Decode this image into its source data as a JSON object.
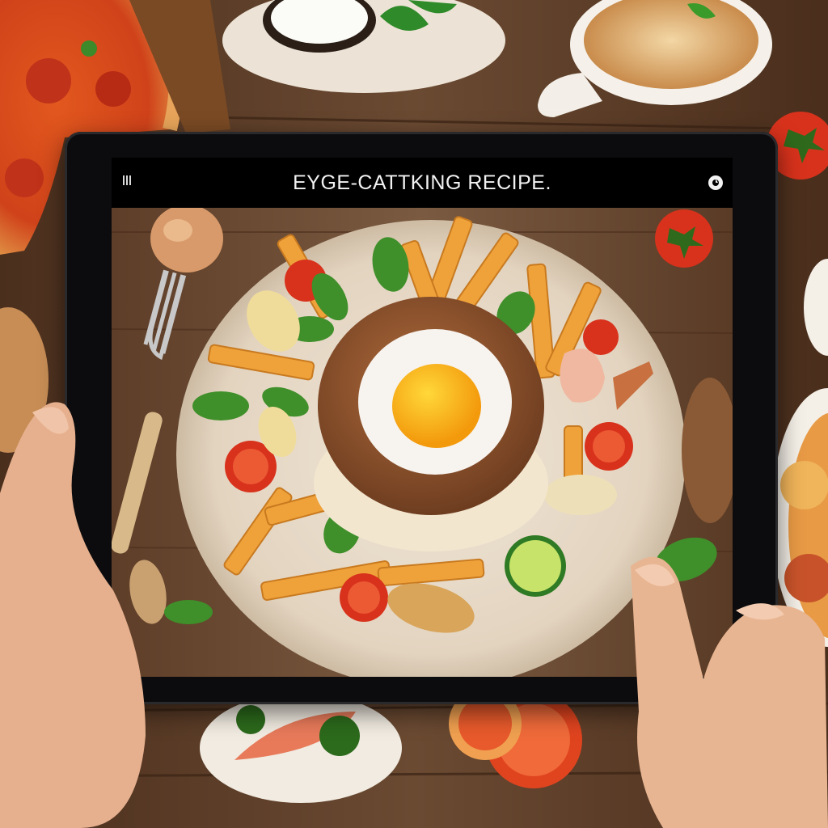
{
  "app": {
    "title": "EYGE-CATTKING RECIPE."
  },
  "icons": {
    "menu": "menu-icon",
    "settings": "settings-icon"
  },
  "colors": {
    "table_wood": "#5a3b26",
    "tablet_bezel": "#0c0c0e",
    "plate": "#e8dccb",
    "bun": "#8a5230",
    "egg_yolk": "#f7b514",
    "fries": "#f0a23a",
    "tomato": "#d8321c",
    "basil": "#3f8f2a"
  }
}
